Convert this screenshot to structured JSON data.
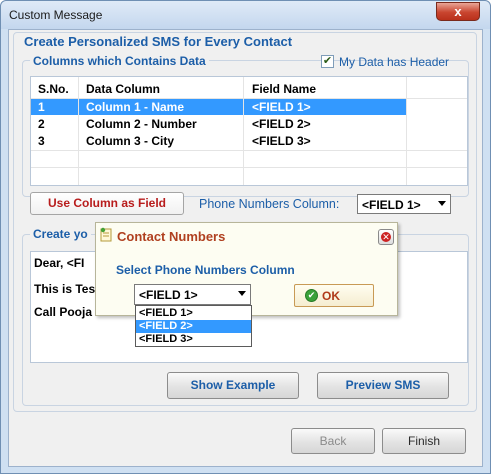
{
  "window": {
    "title": "Custom Message",
    "close_label": "x"
  },
  "main_group": {
    "title": "Create Personalized SMS for Every Contact"
  },
  "columns_group": {
    "title": "Columns which Contains Data",
    "header_checkbox_label": "My Data has Header",
    "header_checked": true
  },
  "grid": {
    "headers": [
      "S.No.",
      "Data Column",
      "Field Name"
    ],
    "rows": [
      {
        "sno": "1",
        "column": "Column 1 - Name",
        "field": "<FIELD 1>",
        "selected": true
      },
      {
        "sno": "2",
        "column": "Column 2 - Number",
        "field": "<FIELD 2>",
        "selected": false
      },
      {
        "sno": "3",
        "column": "Column 3 - City",
        "field": "<FIELD 3>",
        "selected": false
      }
    ]
  },
  "field_bar": {
    "use_column_label": "Use Column as Field",
    "phone_column_label": "Phone Numbers Column:",
    "phone_column_value": "<FIELD 1>"
  },
  "message_group": {
    "title_partial": "Create yo",
    "lines": [
      "Dear, <FI",
      "This is Tes",
      "Call Pooja"
    ]
  },
  "message_buttons": {
    "show_example": "Show Example",
    "preview_sms": "Preview SMS"
  },
  "nav_buttons": {
    "back": "Back",
    "finish": "Finish"
  },
  "popup": {
    "title": "Contact Numbers",
    "label": "Select Phone Numbers Column",
    "selected_value": "<FIELD 1>",
    "options": [
      "<FIELD 1>",
      "<FIELD 2>",
      "<FIELD 3>"
    ],
    "highlighted_option": "<FIELD 2>",
    "ok_label": "OK"
  },
  "colors": {
    "accent_blue": "#1c5ea8",
    "selection": "#3399ff",
    "warning_red": "#b81c1c"
  }
}
